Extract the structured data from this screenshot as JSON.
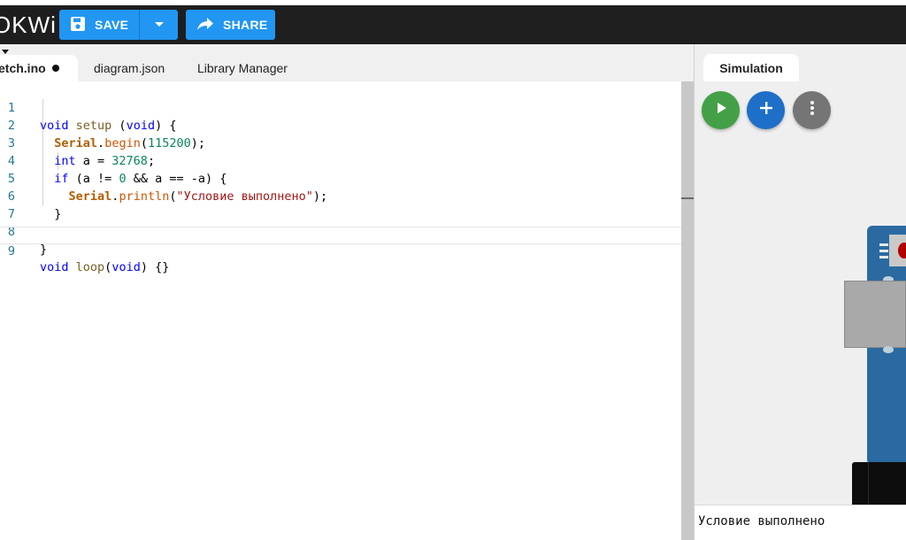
{
  "header": {
    "logo_text": "OKWi",
    "save_label": "SAVE",
    "share_label": "SHARE",
    "accent_color": "#2196f3"
  },
  "editor_tabs": [
    {
      "label": "etch.ino",
      "modified": true
    },
    {
      "label": "diagram.json"
    },
    {
      "label": "Library Manager"
    }
  ],
  "code": {
    "line_numbers": [
      "1",
      "2",
      "3",
      "4",
      "5",
      "6",
      "7",
      "8",
      "9"
    ]
  },
  "simulation": {
    "tab_label": "Simulation",
    "buttons": [
      "play-icon",
      "plus-icon",
      "more-vertical-icon"
    ]
  },
  "serial_monitor": {
    "output": "Условие выполнено"
  }
}
